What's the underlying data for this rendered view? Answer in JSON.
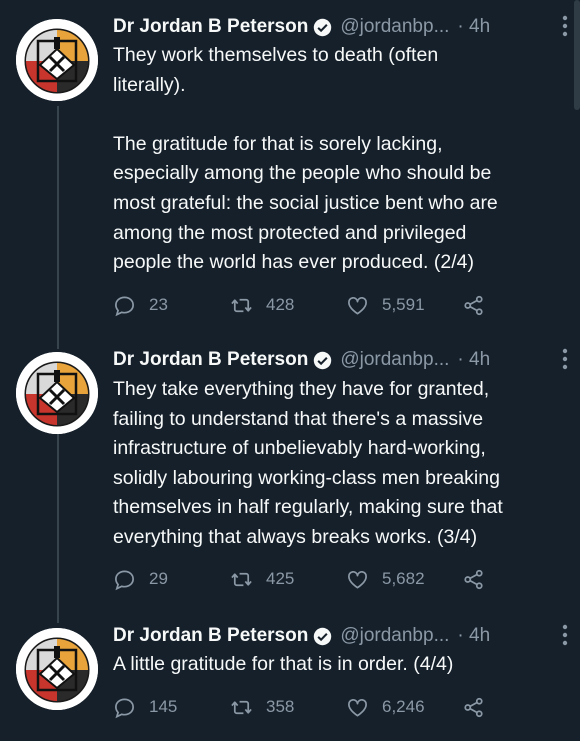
{
  "tweets": [
    {
      "author": "Dr Jordan B Peterson",
      "handle": "@jordanbp...",
      "time": "· 4h",
      "text": "They work themselves to death (often\nliterally).\n\nThe gratitude for that is sorely lacking,\nespecially among the people who should be\nmost grateful: the social justice bent who are\namong the most protected and privileged\npeople the world has ever produced. (2/4)",
      "replies": "23",
      "retweets": "428",
      "likes": "5,591"
    },
    {
      "author": "Dr Jordan B Peterson",
      "handle": "@jordanbp...",
      "time": "· 4h",
      "text": "They take everything they have for granted,\nfailing to understand that there's a massive\ninfrastructure of unbelievably hard-working,\nsolidly labouring working-class men breaking\nthemselves in half regularly, making sure that\neverything that always breaks works. (3/4)",
      "replies": "29",
      "retweets": "425",
      "likes": "5,682"
    },
    {
      "author": "Dr Jordan B Peterson",
      "handle": "@jordanbp...",
      "time": "· 4h",
      "text": "A little gratitude for that is in order. (4/4)",
      "replies": "145",
      "retweets": "358",
      "likes": "6,246"
    }
  ],
  "colors": {
    "background": "#15202b",
    "text": "#f7f9f9",
    "secondary": "#8b98a5",
    "verified": "#1d9bf0",
    "thread_line": "#38444d"
  },
  "icons": {
    "verified": "verified-badge-icon",
    "more": "more-dots-icon",
    "reply": "reply-icon",
    "retweet": "retweet-icon",
    "like": "heart-icon",
    "share": "share-icon"
  }
}
